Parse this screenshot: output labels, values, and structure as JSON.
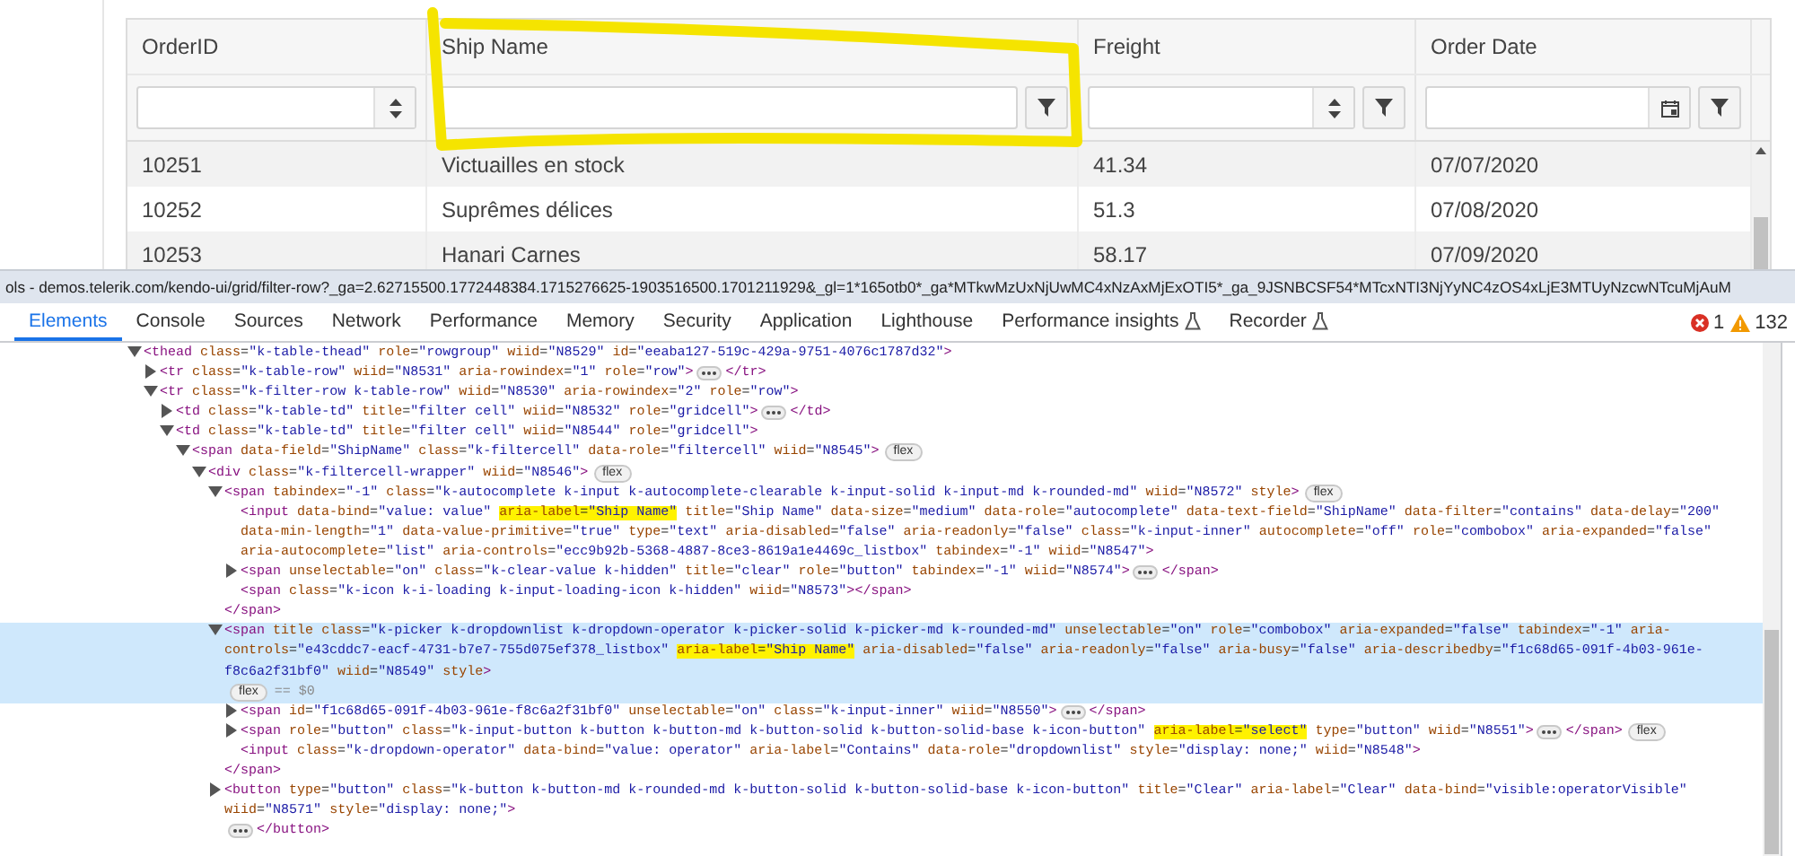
{
  "grid": {
    "columns": [
      {
        "title": "OrderID",
        "kind": "numeric",
        "filter_button": false
      },
      {
        "title": "Ship Name",
        "kind": "text",
        "filter_button": true
      },
      {
        "title": "Freight",
        "kind": "numeric",
        "filter_button": true
      },
      {
        "title": "Order Date",
        "kind": "date",
        "filter_button": true
      }
    ],
    "rows": [
      {
        "cells": [
          "10251",
          "Victuailles en stock",
          "41.34",
          "07/07/2020"
        ]
      },
      {
        "cells": [
          "10252",
          "Suprêmes délices",
          "51.3",
          "07/08/2020"
        ]
      },
      {
        "cells": [
          "10253",
          "Hanari Carnes",
          "58.17",
          "07/09/2020"
        ]
      }
    ]
  },
  "devtools": {
    "title": "ols - demos.telerik.com/kendo-ui/grid/filter-row?_ga=2.62715500.1772448384.1715276625-1903516500.1701211929&_gl=1*165otb0*_ga*MTkwMzUxNjUwMC4xNzAxMjExOTI5*_ga_9JSNBCSF54*MTcxNTI3NjYyNC4zOS4xLjE3MTUyNzcwNTcuMjAuM",
    "tabs": [
      {
        "label": "Elements",
        "selected": true,
        "experimental": false
      },
      {
        "label": "Console",
        "selected": false,
        "experimental": false
      },
      {
        "label": "Sources",
        "selected": false,
        "experimental": false
      },
      {
        "label": "Network",
        "selected": false,
        "experimental": false
      },
      {
        "label": "Performance",
        "selected": false,
        "experimental": false
      },
      {
        "label": "Memory",
        "selected": false,
        "experimental": false
      },
      {
        "label": "Security",
        "selected": false,
        "experimental": false
      },
      {
        "label": "Application",
        "selected": false,
        "experimental": false
      },
      {
        "label": "Lighthouse",
        "selected": false,
        "experimental": false
      },
      {
        "label": "Performance insights",
        "selected": false,
        "experimental": true
      },
      {
        "label": "Recorder",
        "selected": false,
        "experimental": true
      }
    ],
    "error_count": "1",
    "warning_count": "132",
    "dom_tree": [
      {
        "expanded": true,
        "selected": false,
        "parts": [
          {
            "text": "<thead class=\"k-table-thead\" role=\"rowgroup\" wiid=\"N8529\" id=\"eeaba127-519c-429a-9751-4076c1787d32\">",
            "highlighted": false
          }
        ],
        "children": [
          {
            "expanded": false,
            "selected": false,
            "parts": [
              {
                "text": "<tr class=\"k-table-row\" wiid=\"N8531\" aria-rowindex=\"1\" role=\"row\">",
                "highlighted": false
              }
            ],
            "close": "</tr>"
          },
          {
            "expanded": true,
            "selected": false,
            "parts": [
              {
                "text": "<tr class=\"k-filter-row k-table-row\" wiid=\"N8530\" aria-rowindex=\"2\" role=\"row\">",
                "highlighted": false
              }
            ],
            "children": [
              {
                "expanded": false,
                "selected": false,
                "parts": [
                  {
                    "text": "<td class=\"k-table-td\" title=\"filter cell\" wiid=\"N8532\" role=\"gridcell\">",
                    "highlighted": false
                  }
                ],
                "close": "</td>"
              },
              {
                "expanded": true,
                "selected": false,
                "parts": [
                  {
                    "text": "<td class=\"k-table-td\" title=\"filter cell\" wiid=\"N8544\" role=\"gridcell\">",
                    "highlighted": false
                  }
                ],
                "children": [
                  {
                    "expanded": true,
                    "selected": false,
                    "parts": [
                      {
                        "text": "<span data-field=\"ShipName\" class=\"k-filtercell\" data-role=\"filtercell\" wiid=\"N8545\">",
                        "highlighted": false
                      }
                    ],
                    "badge": "flex",
                    "children": [
                      {
                        "expanded": true,
                        "selected": false,
                        "parts": [
                          {
                            "text": "<div class=\"k-filtercell-wrapper\" wiid=\"N8546\">",
                            "highlighted": false
                          }
                        ],
                        "badge": "flex",
                        "children": [
                          {
                            "expanded": true,
                            "selected": false,
                            "parts": [
                              {
                                "text": "<span tabindex=\"-1\" class=\"k-autocomplete k-input k-autocomplete-clearable k-input-solid k-input-md k-rounded-md\" wiid=\"N8572\" style>",
                                "highlighted": false
                              }
                            ],
                            "badge": "flex",
                            "close": "</span>",
                            "children": [
                              {
                                "selected": false,
                                "parts": [
                                  {
                                    "text": "<input data-bind=\"value: value\" ",
                                    "highlighted": false
                                  },
                                  {
                                    "text": "aria-label=\"Ship Name\"",
                                    "highlighted": true
                                  },
                                  {
                                    "text": " title=\"Ship Name\" data-size=\"medium\" data-role=\"autocomplete\" data-text-field=\"ShipName\" data-filter=\"contains\" data-delay=\"200\" data-min-length=\"1\" data-value-primitive=\"true\" type=\"text\" aria-disabled=\"false\" aria-readonly=\"false\" class=\"k-input-inner\" autocomplete=\"off\" role=\"combobox\" aria-expanded=\"false\" aria-autocomplete=\"list\" aria-controls=\"ecc9b92b-5368-4887-8ce3-8619a1e4469c_listbox\" tabindex=\"-1\" wiid=\"N8547\">",
                                    "highlighted": false
                                  }
                                ]
                              },
                              {
                                "expanded": false,
                                "selected": false,
                                "parts": [
                                  {
                                    "text": "<span unselectable=\"on\" class=\"k-clear-value k-hidden\" title=\"clear\" role=\"button\" tabindex=\"-1\" wiid=\"N8574\">",
                                    "highlighted": false
                                  }
                                ],
                                "close": "</span>"
                              },
                              {
                                "selected": false,
                                "parts": [
                                  {
                                    "text": "<span class=\"k-icon k-i-loading k-input-loading-icon k-hidden\" wiid=\"N8573\"></span>",
                                    "highlighted": false
                                  }
                                ]
                              }
                            ]
                          },
                          {
                            "expanded": true,
                            "selected": true,
                            "parts": [
                              {
                                "text": "<span title class=\"k-picker k-dropdownlist k-dropdown-operator k-picker-solid k-picker-md k-rounded-md\" unselectable=\"on\" role=\"combobox\" aria-expanded=\"false\" tabindex=\"-1\" aria-controls=\"e43cddc7-eacf-4731-b7e7-755d075ef378_listbox\" ",
                                "highlighted": false
                              },
                              {
                                "text": "aria-label=\"Ship Name\"",
                                "highlighted": true
                              },
                              {
                                "text": " aria-disabled=\"false\" aria-readonly=\"false\" aria-busy=\"false\" aria-describedby=\"f1c68d65-091f-4b03-961e-f8c6a2f31bf0\" wiid=\"N8549\" style>",
                                "highlighted": false
                              }
                            ],
                            "badge": "flex",
                            "note": "== $0",
                            "close": "</span>",
                            "children": [
                              {
                                "expanded": false,
                                "selected": false,
                                "parts": [
                                  {
                                    "text": "<span id=\"f1c68d65-091f-4b03-961e-f8c6a2f31bf0\" unselectable=\"on\" class=\"k-input-inner\" wiid=\"N8550\">",
                                    "highlighted": false
                                  }
                                ],
                                "close": "</span>"
                              },
                              {
                                "expanded": false,
                                "selected": false,
                                "parts": [
                                  {
                                    "text": "<span role=\"button\" class=\"k-input-button k-button k-button-md k-button-solid k-button-solid-base k-icon-button\" ",
                                    "highlighted": false
                                  },
                                  {
                                    "text": "aria-label=\"select\"",
                                    "highlighted": true
                                  },
                                  {
                                    "text": " type=\"button\" wiid=\"N8551\">",
                                    "highlighted": false
                                  }
                                ],
                                "close": "</span>",
                                "badge": "flex"
                              },
                              {
                                "selected": false,
                                "parts": [
                                  {
                                    "text": "<input class=\"k-dropdown-operator\" data-bind=\"value: operator\" aria-label=\"Contains\" data-role=\"dropdownlist\" style=\"display: none;\" wiid=\"N8548\">",
                                    "highlighted": false
                                  }
                                ]
                              }
                            ]
                          },
                          {
                            "expanded": false,
                            "selected": false,
                            "parts": [
                              {
                                "text": "<button type=\"button\" class=\"k-button k-button-md k-rounded-md k-button-solid k-button-solid-base k-icon-button\" title=\"Clear\" aria-label=\"Clear\" data-bind=\"visible:operatorVisible\" wiid=\"N8571\" style=\"display: none;\">",
                                "highlighted": false
                              }
                            ],
                            "close": "</button>"
                          }
                        ]
                      }
                    ]
                  }
                ]
              }
            ]
          }
        ]
      }
    ]
  }
}
